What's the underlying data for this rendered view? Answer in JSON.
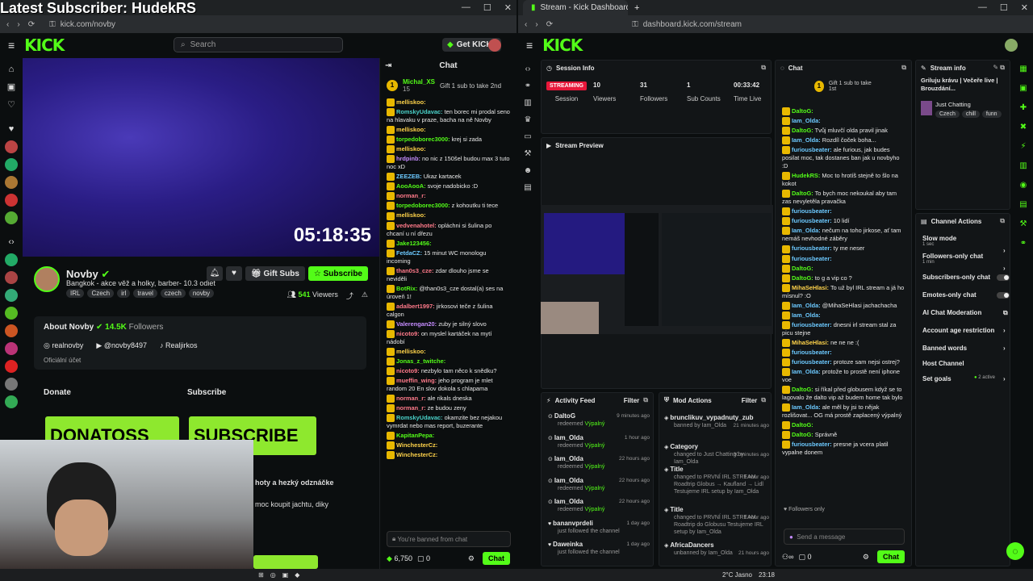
{
  "overlay_title": "Latest Subscriber: HudekRS",
  "left": {
    "url": "kick.com/novby",
    "search_placeholder": "Search",
    "get_kicks": "Get KICKs",
    "video_time": "05:18:35",
    "channel_name": "Novby",
    "channel_desc": "Bangkok - akce věž a holky, barber- 10.3 odiet",
    "tags": [
      "IRL",
      "Czech",
      "irl",
      "travel",
      "czech",
      "novby"
    ],
    "gift_subs": "Gift Subs",
    "subscribe": "Subscribe",
    "viewers": "541",
    "viewers_label": "Viewers",
    "about_title": "About Novby",
    "followers": "14.5K",
    "followers_label": "Followers",
    "links": [
      "realnovby",
      "@novby8497",
      "Realjirkos"
    ],
    "official": "Oficiální účet",
    "donate": "Donate",
    "subscribe_section": "Subscribe",
    "donate_banner": "DONATOSS",
    "sub_banner": "SUBSCRIBE",
    "extra_text1": "hoty a hezký odznáčke",
    "extra_text2": "moc koupit jachtu, diky"
  },
  "chat_left": {
    "title": "Chat",
    "pinned_user": "Michal_XS",
    "pinned_sub": "15",
    "pinned_text": "Gift 1 sub to take 2nd",
    "messages": [
      {
        "u": "melliskoo:",
        "t": "",
        "c": "nm3"
      },
      {
        "u": "RomskyUdavac:",
        "t": "ten borec mi prodal seno na hlavaku v praze, bacha na ně Novby",
        "c": "nm6"
      },
      {
        "u": "melliskoo:",
        "t": "",
        "c": "nm3"
      },
      {
        "u": "torpedoborec3000:",
        "t": "krej si zada",
        "c": "nm4"
      },
      {
        "u": "melliskoo:",
        "t": "",
        "c": "nm3"
      },
      {
        "u": "hrdpinb:",
        "t": "no nic z 150šel budou max 3 tuto noc xD",
        "c": "nm5"
      },
      {
        "u": "ZEEZEB:",
        "t": "Ukaz kartacek",
        "c": "nm1"
      },
      {
        "u": "AooAooA:",
        "t": "svoje nadobicko :D",
        "c": "nm4"
      },
      {
        "u": "norman_r:",
        "t": "",
        "c": "nm2"
      },
      {
        "u": "torpedoborec3000:",
        "t": "z kohoutku ti tece",
        "c": "nm4"
      },
      {
        "u": "melliskoo:",
        "t": "",
        "c": "nm3"
      },
      {
        "u": "vedvenahotel:",
        "t": "opláchni si šulina po chcaní u ní dřezu",
        "c": "nm2"
      },
      {
        "u": "Jake123456:",
        "t": "",
        "c": "nm4"
      },
      {
        "u": "FetdaCZ:",
        "t": "15 minut WC monologu incoming",
        "c": "nm1"
      },
      {
        "u": "than0s3_cze:",
        "t": "zdar dlouho jsme se neviděli",
        "c": "nm2"
      },
      {
        "u": "BotRix:",
        "t": "@than0s3_cze dostal(a) ses na úroveň 1!",
        "c": "nm4"
      },
      {
        "u": "adalbert1997:",
        "t": "jirkosovi teče z šulina calgon",
        "c": "nm2"
      },
      {
        "u": "Valerengan20:",
        "t": "zuby je silný slovo",
        "c": "nm5"
      },
      {
        "u": "nicoto9:",
        "t": "on myslel kartáček na mytí nádobí",
        "c": "nm2"
      },
      {
        "u": "melliskoo:",
        "t": "",
        "c": "nm3"
      },
      {
        "u": "Jonas_z_twitche:",
        "t": "",
        "c": "nm4"
      },
      {
        "u": "nicoto9:",
        "t": "nezbylo tam něco k snědku?",
        "c": "nm2"
      },
      {
        "u": "mueffin_wing:",
        "t": "jeho program je mlet random 20 En slov dokola s chlapama",
        "c": "nm2"
      },
      {
        "u": "norman_r:",
        "t": "ale rikals dneska",
        "c": "nm2"
      },
      {
        "u": "norman_r:",
        "t": "ze budou zeny",
        "c": "nm2"
      },
      {
        "u": "RomskyUdavac:",
        "t": "okamzite bez nejakou vymrdat nebo mas report, buzerante",
        "c": "nm6"
      },
      {
        "u": "KapitanPepa:",
        "t": "",
        "c": "nm4"
      },
      {
        "u": "WinchesterCz:",
        "t": "",
        "c": "nm3"
      },
      {
        "u": "WinchesterCz:",
        "t": "",
        "c": "nm3"
      }
    ],
    "input_placeholder": "You're banned from chat",
    "kicks": "6,750",
    "zero": "0",
    "chat_btn": "Chat"
  },
  "right": {
    "tab_title": "Stream - Kick Dashboard",
    "url": "dashboard.kick.com/stream",
    "session_title": "Session Info",
    "session_status": "STREAMING",
    "session_label": "Session",
    "stats": [
      {
        "v": "10",
        "l": "Viewers"
      },
      {
        "v": "31",
        "l": "Followers"
      },
      {
        "v": "1",
        "l": "Sub Counts"
      },
      {
        "v": "00:33:42",
        "l": "Time Live"
      }
    ],
    "preview_title": "Stream Preview",
    "activity_title": "Activity Feed",
    "activity_filter": "Filter",
    "activity": [
      {
        "n": "DaltoG",
        "a": "redeemed",
        "g": "Výpalný",
        "t": "9 minutes ago"
      },
      {
        "n": "Iam_Olda",
        "a": "redeemed",
        "g": "Výpalný",
        "t": "1 hour ago"
      },
      {
        "n": "Iam_Olda",
        "a": "redeemed",
        "g": "Výpalný",
        "t": "22 hours ago"
      },
      {
        "n": "Iam_Olda",
        "a": "redeemed",
        "g": "Výpalný",
        "t": "22 hours ago"
      },
      {
        "n": "Iam_Olda",
        "a": "redeemed",
        "g": "Výpalný",
        "t": "22 hours ago"
      },
      {
        "n": "bananvprdeli",
        "a": "just followed the channel",
        "g": "",
        "t": "1 day ago"
      },
      {
        "n": "Daweinka",
        "a": "just followed the channel",
        "g": "",
        "t": "1 day ago"
      }
    ],
    "mod_title": "Mod Actions",
    "mod_filter": "Filter",
    "mods": [
      {
        "n": "brunclikuv_vypadnuty_zub",
        "d": "banned by Iam_Olda",
        "t": "21 minutes ago"
      },
      {
        "n": "Category",
        "d": "changed to Just Chatting by Iam_Olda",
        "t": "30 minutes ago"
      },
      {
        "n": "Title",
        "d": "changed to PRVNÍ IRL STREAM Roadtrip Globus → Kaufland → Lidl Testujeme IRL setup by Iam_Olda",
        "t": "1 hour ago"
      },
      {
        "n": "Title",
        "d": "changed to PRVNÍ IRL STREAM Roadtrip do Globusu Testujeme IRL setup by Iam_Olda",
        "t": "1 hour ago"
      },
      {
        "n": "AfricaDancers",
        "d": "unbanned by Iam_Olda",
        "t": "21 hours ago"
      }
    ],
    "chat_title": "Chat",
    "pinned_text": "Gift 1 sub to take 1st",
    "chat": [
      {
        "u": "DaltoG:",
        "t": "",
        "c": "nm4"
      },
      {
        "u": "Iam_Olda:",
        "t": "",
        "c": "nm1"
      },
      {
        "u": "DaltoG:",
        "t": "Tvůj mluvčí olda pravil jinak",
        "c": "nm4"
      },
      {
        "u": "Iam_Olda:",
        "t": "Rozdíl čoček boha...",
        "c": "nm1"
      },
      {
        "u": "furiousbeater:",
        "t": "ale furious, jak budes posilat moc, tak dostanes ban jak u novbyho :D",
        "c": "nm1"
      },
      {
        "u": "HudekRS:",
        "t": "Moc to hrotíš stejně to šlo na kokot",
        "c": "nm4"
      },
      {
        "u": "DaltoG:",
        "t": "To bych moc nekoukal aby tam zas nevyletěla pravačka",
        "c": "nm4"
      },
      {
        "u": "furiousbeater:",
        "t": "",
        "c": "nm1"
      },
      {
        "u": "furiousbeater:",
        "t": "10 lidí",
        "c": "nm1"
      },
      {
        "u": "Iam_Olda:",
        "t": "nečum na toho jirkose, ať tam nemáš nevhodné záběry",
        "c": "nm1"
      },
      {
        "u": "furiousbeater:",
        "t": "ty me neser",
        "c": "nm1"
      },
      {
        "u": "furiousbeater:",
        "t": "",
        "c": "nm1"
      },
      {
        "u": "DaltoG:",
        "t": "",
        "c": "nm4"
      },
      {
        "u": "DaltoG:",
        "t": "to g a vip co ?",
        "c": "nm4"
      },
      {
        "u": "MihaSeHlasi:",
        "t": "To už byl IRL stream a já ho mísnul? :O",
        "c": "nm3"
      },
      {
        "u": "Iam_Olda:",
        "t": "@MihaSeHlasi jachachacha",
        "c": "nm1"
      },
      {
        "u": "Iam_Olda:",
        "t": "",
        "c": "nm1"
      },
      {
        "u": "furiousbeater:",
        "t": "dnesni irl stream stal za picu stejne",
        "c": "nm1"
      },
      {
        "u": "MihaSeHlasi:",
        "t": "ne ne ne :(",
        "c": "nm3"
      },
      {
        "u": "furiousbeater:",
        "t": "",
        "c": "nm1"
      },
      {
        "u": "furiousbeater:",
        "t": "protoze sam nejsi ostrej?",
        "c": "nm1"
      },
      {
        "u": "Iam_Olda:",
        "t": "protože to prostě není iphone voe",
        "c": "nm1"
      },
      {
        "u": "DaltoG:",
        "t": "si říkal před globusem když se to lagovalo že dalto vip až budem home tak bylo",
        "c": "nm4"
      },
      {
        "u": "Iam_Olda:",
        "t": "ale měl by jsi to nějak rozlišovat... OG má prostě zaplacený výpalný",
        "c": "nm1"
      },
      {
        "u": "DaltoG:",
        "t": "",
        "c": "nm4"
      },
      {
        "u": "DaltoG:",
        "t": "Správně",
        "c": "nm4"
      },
      {
        "u": "furiousbeater:",
        "t": "presne ja vcera platil vypalne donem",
        "c": "nm1"
      }
    ],
    "followers_only": "Followers only",
    "send_placeholder": "Send a message",
    "zero": "0",
    "chat_btn": "Chat",
    "stream_info_title": "Stream info",
    "stream_title": "Griluju krávu | Večeře live | Brouzdání...",
    "category": "Just Chatting",
    "info_tags": [
      "Czech",
      "chill",
      "funn"
    ],
    "channel_actions_title": "Channel Actions",
    "actions": [
      {
        "l": "Slow mode",
        "s": "1 sec"
      },
      {
        "l": "Followers-only chat",
        "s": "1 min"
      },
      {
        "l": "Subscribers-only chat",
        "s": ""
      },
      {
        "l": "Emotes-only chat",
        "s": ""
      },
      {
        "l": "AI Chat Moderation",
        "s": ""
      },
      {
        "l": "Account age restriction",
        "s": ""
      },
      {
        "l": "Banned words",
        "s": ""
      },
      {
        "l": "Host Channel",
        "s": ""
      },
      {
        "l": "Set goals",
        "s": ""
      }
    ],
    "goals_active": "2 active"
  },
  "taskbar": {
    "weather": "2°C Jasno",
    "time": "23:18"
  }
}
